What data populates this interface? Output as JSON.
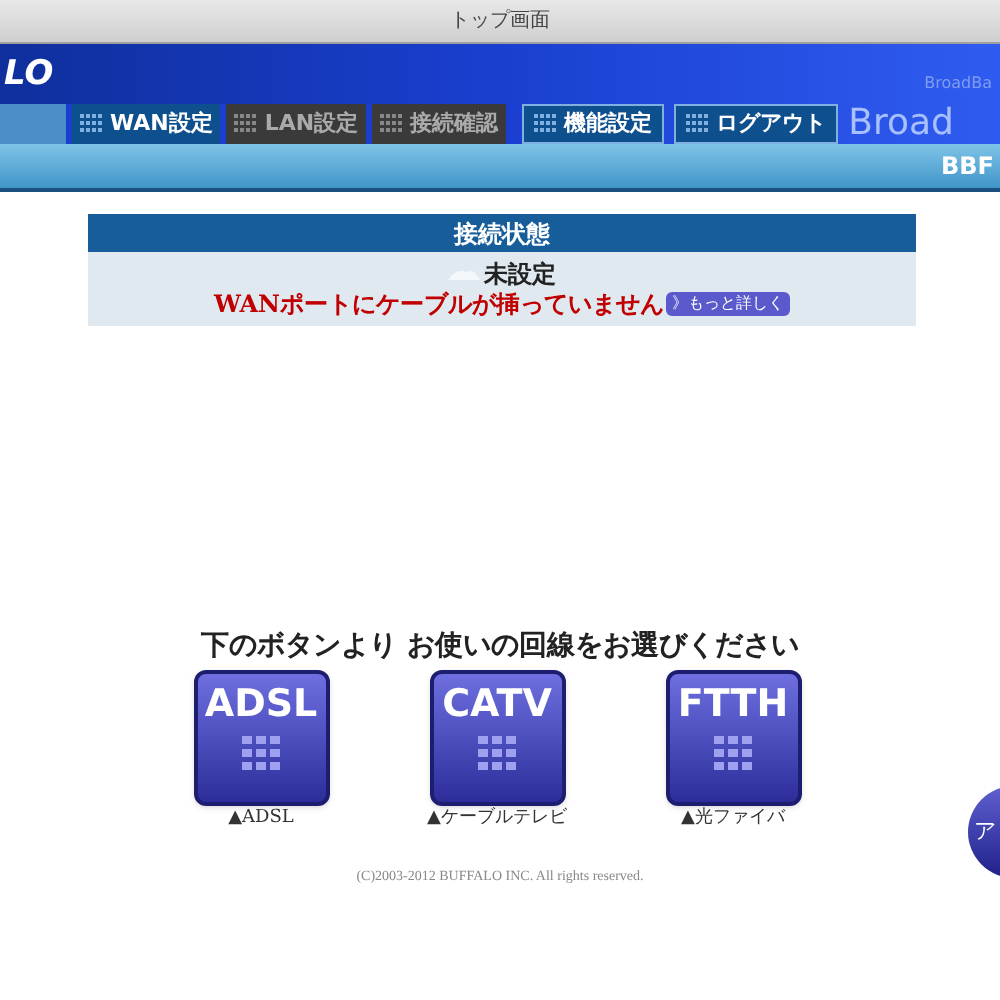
{
  "window": {
    "title": "トップ画面"
  },
  "header": {
    "logo": "LO",
    "brand_small": "BroadBa",
    "brand_large": "Broad",
    "sub_bar": "BBF"
  },
  "tabs": [
    {
      "selected": true,
      "disabled": false,
      "kind": "blank"
    },
    {
      "label": "WAN設定",
      "selected": false,
      "disabled": false,
      "kind": "arrow"
    },
    {
      "label": "LAN設定",
      "selected": false,
      "disabled": true,
      "kind": "arrow"
    },
    {
      "label": "接続確認",
      "selected": false,
      "disabled": true,
      "kind": "arrow"
    },
    {
      "label": "機能設定",
      "selected": false,
      "disabled": false,
      "kind": "box"
    },
    {
      "label": "ログアウト",
      "selected": false,
      "disabled": false,
      "kind": "box"
    }
  ],
  "status": {
    "title": "接続状態",
    "state": "未設定",
    "message": "WANポートにケーブルが挿っていません",
    "details_button": "》もっと詳しく"
  },
  "prompt": "下のボタンより お使いの回線をお選びください",
  "lines": [
    {
      "label": "ADSL",
      "caption": "▲ADSL"
    },
    {
      "label": "CATV",
      "caption": "▲ケーブルテレビ"
    },
    {
      "label": "FTTH",
      "caption": "▲光ファイバ"
    }
  ],
  "side_button": "ア",
  "copyright": "(C)2003-2012 BUFFALO INC. All rights reserved."
}
